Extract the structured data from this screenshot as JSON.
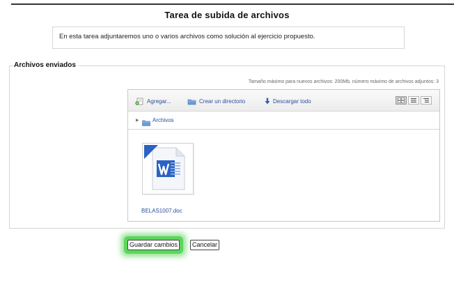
{
  "page": {
    "title": "Tarea de subida de archivos",
    "intro": "En esta tarea adjuntaremos uno o varios archivos como solución al ejercicio propuesto."
  },
  "section": {
    "legend": "Archivos enviados",
    "limits": "Tamaño máximo para nuevos archivos: 200Mb, número máximo de archivos adjuntos: 3"
  },
  "filepicker": {
    "toolbar": {
      "add_label": "Agregar...",
      "mkdir_label": "Crear un directorio",
      "download_label": "Descargar todo",
      "view_modes": [
        {
          "icon": "grid-view-icon",
          "active": true
        },
        {
          "icon": "list-view-icon",
          "active": false
        },
        {
          "icon": "tree-view-icon",
          "active": false
        }
      ]
    },
    "path": {
      "folder_label": "Archivos",
      "icon": "folder-icon"
    },
    "files": [
      {
        "name": "BELAS1007.doc",
        "icon": "word-document-icon"
      }
    ]
  },
  "actions": {
    "save_label": "Guardar cambios",
    "cancel_label": "Cancelar"
  },
  "colors": {
    "link": "#2a4f9e",
    "highlight": "#5bd65b",
    "word_blue": "#2b62c4"
  }
}
